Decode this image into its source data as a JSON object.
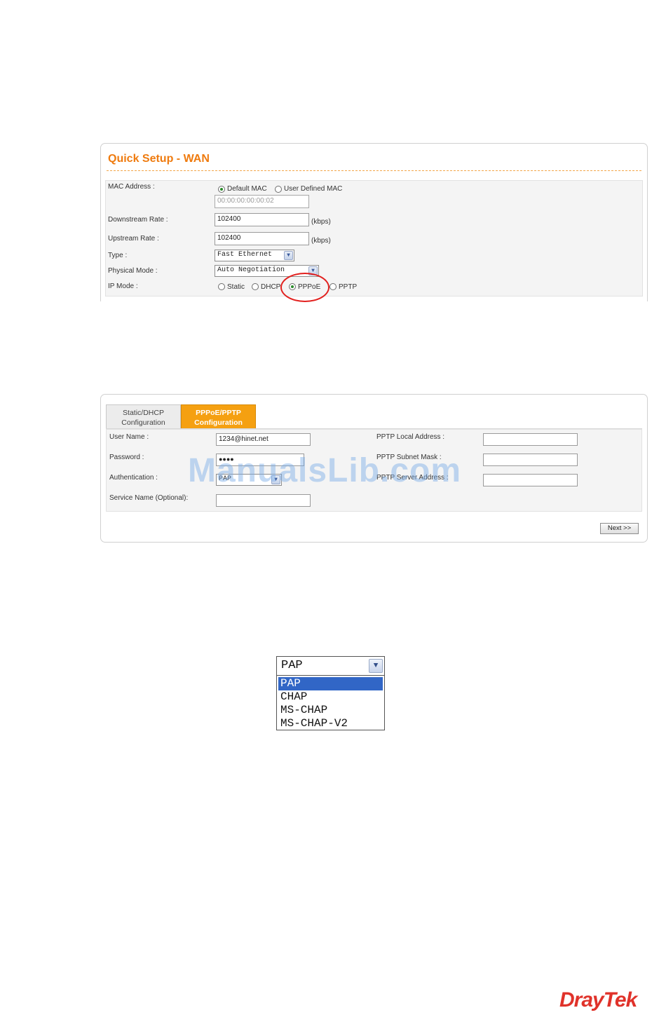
{
  "wan": {
    "title": "Quick Setup - WAN",
    "mac_label": "MAC Address :",
    "mac_default": "Default MAC",
    "mac_user": "User Defined MAC",
    "mac_value": "00:00:00:00:00:02",
    "downstream_label": "Downstream Rate :",
    "downstream_value": "102400",
    "downstream_unit": "(kbps)",
    "upstream_label": "Upstream Rate :",
    "upstream_value": "102400",
    "upstream_unit": "(kbps)",
    "type_label": "Type :",
    "type_value": "Fast Ethernet",
    "physical_label": "Physical Mode :",
    "physical_value": "Auto Negotiation",
    "ipmode_label": "IP Mode :",
    "ipmode_options": [
      "Static",
      "DHCP",
      "PPPoE",
      "PPTP"
    ],
    "ipmode_selected": "PPPoE"
  },
  "ppp": {
    "tab_static_line1": "Static/DHCP",
    "tab_static_line2": "Configuration",
    "tab_ppp_line1": "PPPoE/PPTP",
    "tab_ppp_line2": "Configuration",
    "username_label": "User Name :",
    "username_value": "1234@hinet.net",
    "password_label": "Password :",
    "password_value": "●●●●",
    "auth_label": "Authentication :",
    "auth_value": "PAP",
    "service_label": "Service Name (Optional):",
    "service_value": "",
    "pptp_local_label": "PPTP Local Address :",
    "pptp_mask_label": "PPTP Subnet Mask :",
    "pptp_server_label": "PPTP Server Address :",
    "next_label": "Next >>"
  },
  "watermark": "ManualsLib.com",
  "auth_dropdown": {
    "selected": "PAP",
    "options": [
      "PAP",
      "CHAP",
      "MS-CHAP",
      "MS-CHAP-V2"
    ],
    "highlighted": "PAP"
  },
  "logo": "DrayTek",
  "colors": {
    "title_orange": "#ef7b0f",
    "tab_active": "#f5a011",
    "highlight_circle": "#e2201e",
    "dropdown_selected": "#3166c6",
    "logo_red": "#e0322a"
  }
}
